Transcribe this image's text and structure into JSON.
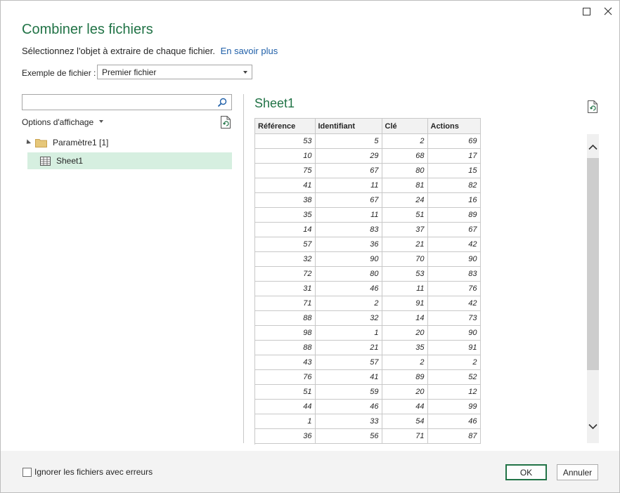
{
  "dialog": {
    "title": "Combiner les fichiers",
    "subtitle": "Sélectionnez l'objet à extraire de chaque fichier.",
    "learn_more": "En savoir plus",
    "sample_label": "Exemple de fichier :",
    "sample_value": "Premier fichier"
  },
  "nav": {
    "search_placeholder": "",
    "display_options": "Options d'affichage",
    "tree": {
      "parent_label": "Paramètre1 [1]",
      "child_label": "Sheet1"
    }
  },
  "preview": {
    "title": "Sheet1",
    "columns": [
      "Référence",
      "Identifiant",
      "Clé",
      "Actions"
    ],
    "rows": [
      [
        53,
        5,
        2,
        69
      ],
      [
        10,
        29,
        68,
        17
      ],
      [
        75,
        67,
        80,
        15
      ],
      [
        41,
        11,
        81,
        82
      ],
      [
        38,
        67,
        24,
        16
      ],
      [
        35,
        11,
        51,
        89
      ],
      [
        14,
        83,
        37,
        67
      ],
      [
        57,
        36,
        21,
        42
      ],
      [
        32,
        90,
        70,
        90
      ],
      [
        72,
        80,
        53,
        83
      ],
      [
        31,
        46,
        11,
        76
      ],
      [
        71,
        2,
        91,
        42
      ],
      [
        88,
        32,
        14,
        73
      ],
      [
        98,
        1,
        20,
        90
      ],
      [
        88,
        21,
        35,
        91
      ],
      [
        43,
        57,
        2,
        2
      ],
      [
        76,
        41,
        89,
        52
      ],
      [
        51,
        59,
        20,
        12
      ],
      [
        44,
        46,
        44,
        99
      ],
      [
        1,
        33,
        54,
        46
      ],
      [
        36,
        56,
        71,
        87
      ]
    ]
  },
  "footer": {
    "checkbox_label": "Ignorer les fichiers avec erreurs",
    "ok_label": "OK",
    "cancel_label": "Annuler"
  },
  "colors": {
    "accent": "#217346",
    "selected_bg": "#d6efe0",
    "link": "#1f5fa8"
  },
  "icons": [
    "maximize-icon",
    "close-icon",
    "search-icon",
    "refresh-icon",
    "folder-icon",
    "table-icon",
    "expand-arrow-icon"
  ]
}
